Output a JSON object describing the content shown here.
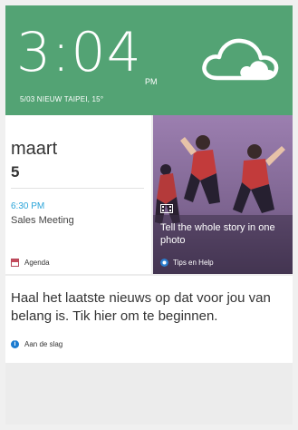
{
  "header": {
    "time": "3:04",
    "ampm": "PM",
    "date_location": "5/03   NIEUW TAIPEI, 15°",
    "weather_icon": "cloud-icon",
    "color": "#53a374"
  },
  "agenda": {
    "month": "maart",
    "day": "5",
    "event_time": "6:30 PM",
    "event_title": "Sales Meeting",
    "footer_label": "Agenda",
    "footer_icon": "calendar-icon",
    "accent": "#2aa4d9"
  },
  "tips": {
    "text": "Tell the whole story in one photo",
    "footer_label": "Tips en Help",
    "icon": "film-icon",
    "footer_icon": "tips-dot-icon"
  },
  "feed": {
    "text": "Haal het laatste nieuws op dat voor jou van belang is. Tik hier om te beginnen.",
    "footer_label": "Aan de slag",
    "footer_icon": "info-icon"
  }
}
